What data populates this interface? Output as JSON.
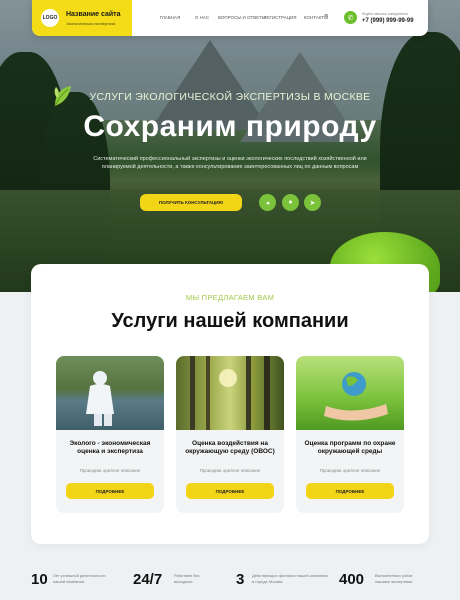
{
  "header": {
    "logo_text": "LOGO",
    "site_name": "Название сайта",
    "site_tagline": "Экологическая экспертиза",
    "nav": [
      "Главная",
      "О нас",
      "Вопросы и ответы",
      "Регистрация",
      "Контакты"
    ],
    "more_icon": "hamburger-icon",
    "phone_note": "Ждём звонка ежедневно",
    "phone": "+7 (999) 999-99-99"
  },
  "hero": {
    "kicker": "Услуги экологической экспертизы в Москве",
    "title": "Сохраним природу",
    "description": "Систематический профессиональный экспертизы и оценки экологических последствий хозяйственной или планируемой деятельности, а также консультирование заинтересованных лиц по данным вопросам",
    "cta": "Получить консультацию",
    "socials": [
      "vk-icon",
      "whatsapp-icon",
      "telegram-icon"
    ]
  },
  "services": {
    "kicker": "Мы предлагаем вам",
    "title": "Услуги нашей компании",
    "cards": [
      {
        "title": "Эколого - экономическая оценка и экспертиза",
        "desc": "Проводим, краткое описание",
        "button": "Подробнее"
      },
      {
        "title": "Оценка воздействия на окружающую среду (ОВОС)",
        "desc": "Проводим, краткое описание",
        "button": "Подробнее"
      },
      {
        "title": "Оценка программ по охране окружающей среды",
        "desc": "Проводим, краткое описание",
        "button": "Подробнее"
      }
    ]
  },
  "stats": [
    {
      "value": "10",
      "label": "Лет успешной деятельности нашей компании"
    },
    {
      "value": "24/7",
      "label": "Работаем без выходных"
    },
    {
      "value": "3",
      "label": "Действующих филиала нашей компании в городе Москва"
    },
    {
      "value": "400",
      "label": "Выполненных работ нашими экспертами"
    }
  ],
  "colors": {
    "accent_yellow": "#f2d516",
    "accent_green": "#7ac23a",
    "kicker_green": "#a4c94a"
  }
}
